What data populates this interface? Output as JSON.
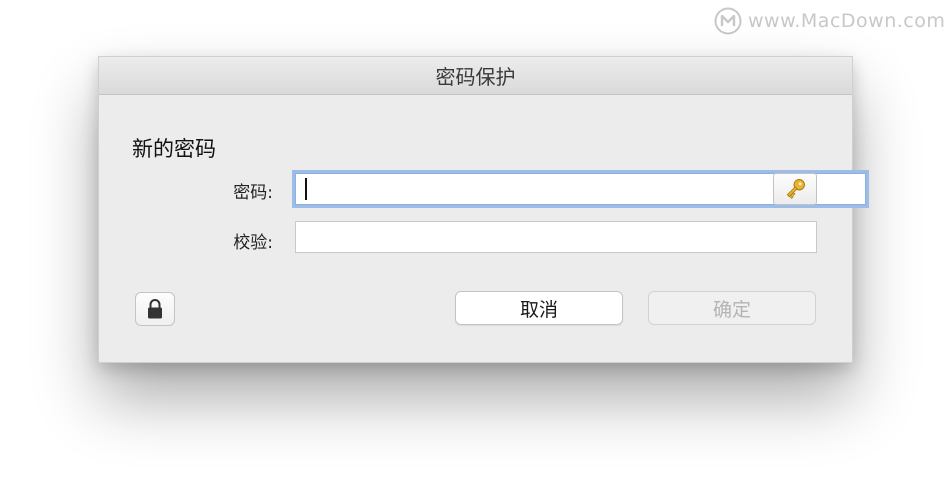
{
  "watermark": {
    "logo_icon": "macdown-m-logo-icon",
    "text": "www.MacDown.com"
  },
  "dialog": {
    "title": "密码保护",
    "section_title": "新的密码",
    "password": {
      "label": "密码:",
      "value": "",
      "focused": true
    },
    "verify": {
      "label": "校验:",
      "value": ""
    },
    "password_assistant_icon": "key-icon",
    "lock_icon": "lock-icon",
    "buttons": {
      "cancel": "取消",
      "confirm": "确定",
      "confirm_enabled": false
    }
  },
  "colors": {
    "focus_ring": "#9bbde8",
    "dialog_bg": "#ececec",
    "key_gold": "#d9a520",
    "disabled_text": "#b4b4b4"
  }
}
